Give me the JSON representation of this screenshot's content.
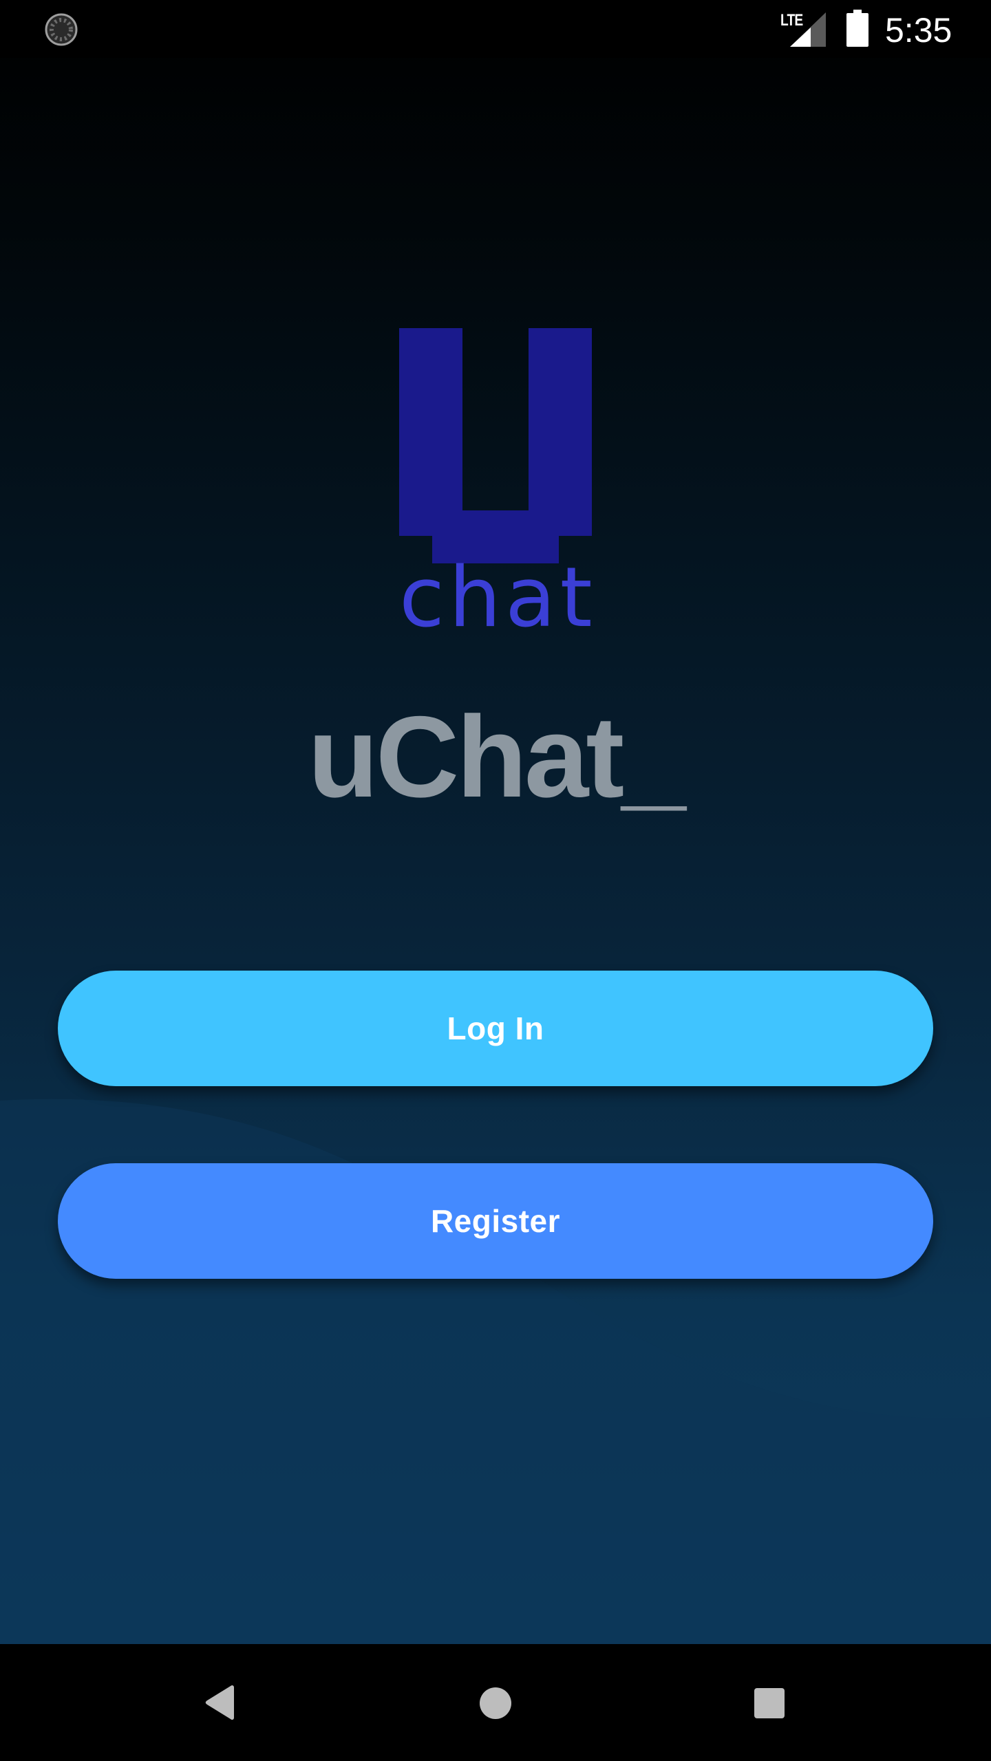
{
  "status_bar": {
    "time": "5:35",
    "network_label": "LTE",
    "icons": [
      "loading-spinner-icon",
      "signal-icon",
      "battery-icon"
    ]
  },
  "logo": {
    "mark": "U",
    "text": "chat",
    "color": "#1a1a8c",
    "text_color": "#3b3fd6"
  },
  "app_title": "uChat_",
  "buttons": {
    "login_label": "Log In",
    "register_label": "Register"
  },
  "navigation": {
    "icons": [
      "back-icon",
      "home-icon",
      "recents-icon"
    ]
  },
  "colors": {
    "login_button": "#40c4ff",
    "register_button": "#448aff",
    "title_text": "#8d98a1",
    "background_top": "#000000",
    "background_bottom": "#0d3b5e"
  }
}
